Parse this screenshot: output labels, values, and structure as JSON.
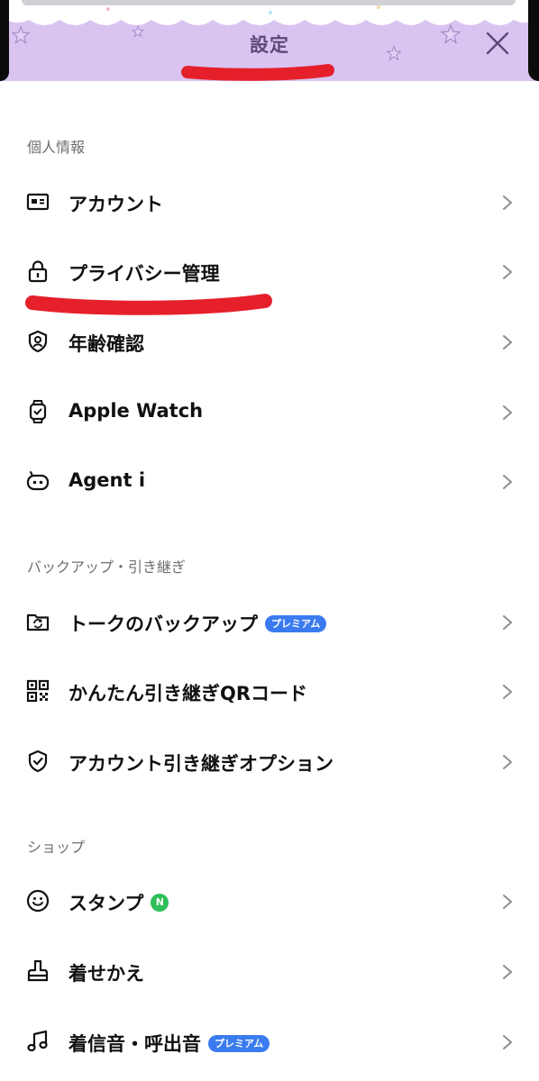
{
  "header": {
    "title": "設定",
    "close_icon": "close-icon",
    "background": "#d9c4f1"
  },
  "sections": [
    {
      "title": "個人情報",
      "items": [
        {
          "label": "アカウント",
          "icon": "id-card-icon"
        },
        {
          "label": "プライバシー管理",
          "icon": "lock-icon"
        },
        {
          "label": "年齢確認",
          "icon": "shield-user-icon"
        },
        {
          "label": "Apple Watch",
          "icon": "watch-icon"
        },
        {
          "label": "Agent i",
          "icon": "robot-icon"
        }
      ]
    },
    {
      "title": "バックアップ・引き継ぎ",
      "items": [
        {
          "label": "トークのバックアップ",
          "icon": "backup-folder-icon",
          "badge": "プレミアム"
        },
        {
          "label": "かんたん引き継ぎQRコード",
          "icon": "qr-code-icon"
        },
        {
          "label": "アカウント引き継ぎオプション",
          "icon": "shield-check-icon"
        }
      ]
    },
    {
      "title": "ショップ",
      "items": [
        {
          "label": "スタンプ",
          "icon": "smiley-icon",
          "new_badge": "N"
        },
        {
          "label": "着せかえ",
          "icon": "brush-icon"
        },
        {
          "label": "着信音・呼出音",
          "icon": "music-note-icon",
          "badge": "プレミアム"
        }
      ]
    }
  ],
  "colors": {
    "badge": "#3a7bf0",
    "new_badge": "#2fbf5b",
    "annotation": "#e5202b",
    "section_title": "#6e6e73"
  }
}
